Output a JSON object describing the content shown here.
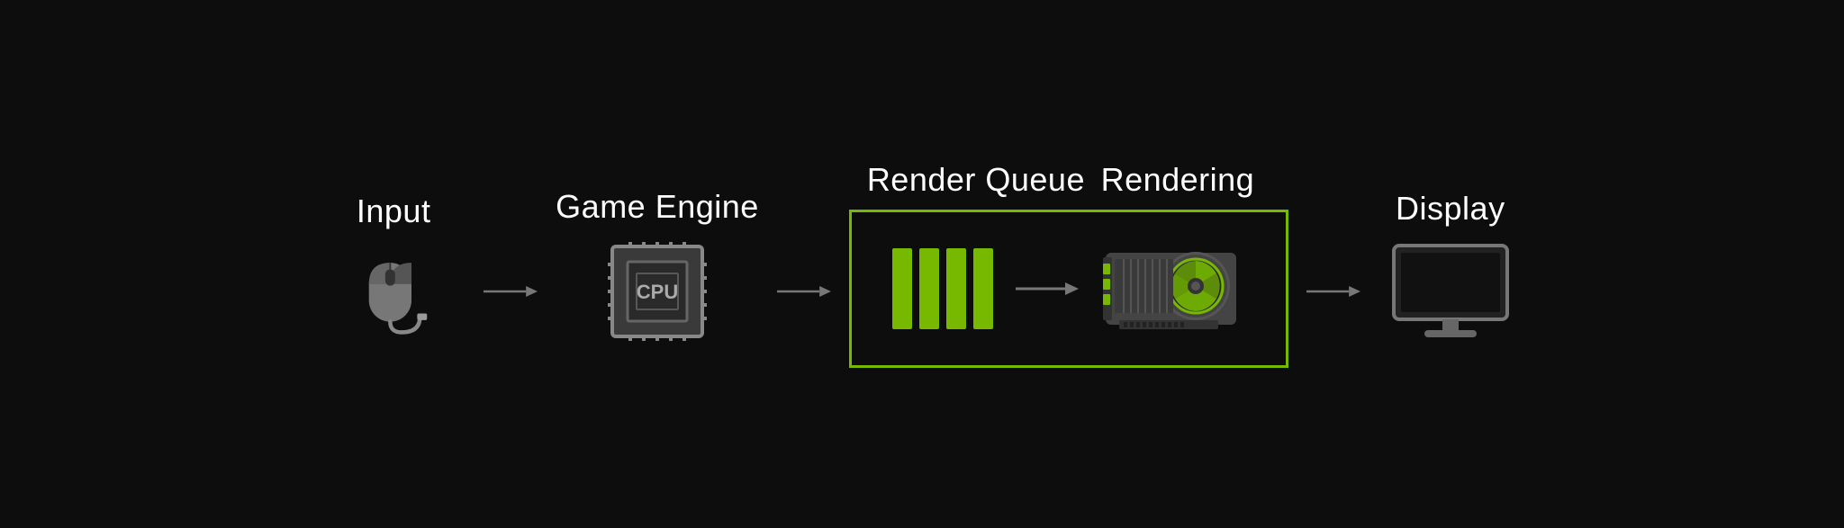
{
  "pipeline": {
    "stages": [
      {
        "id": "input",
        "label": "Input",
        "icon": "mouse-icon"
      },
      {
        "id": "game-engine",
        "label": "Game Engine",
        "icon": "cpu-icon"
      },
      {
        "id": "render-queue",
        "label": "Render Queue",
        "icon": "queue-icon"
      },
      {
        "id": "rendering",
        "label": "Rendering",
        "icon": "gpu-icon"
      },
      {
        "id": "display",
        "label": "Display",
        "icon": "monitor-icon"
      }
    ],
    "colors": {
      "green": "#76b900",
      "gray": "#777777",
      "dark_gray": "#555555",
      "background": "#0d0d0d",
      "text": "#ffffff"
    }
  }
}
